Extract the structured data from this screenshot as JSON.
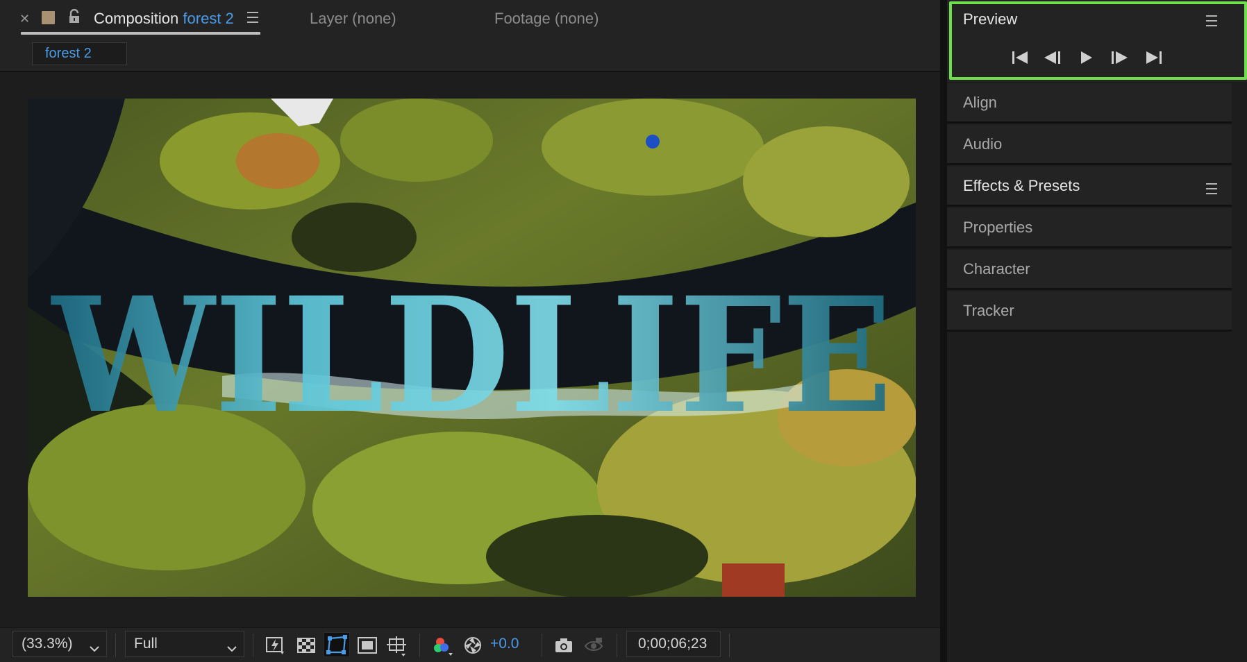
{
  "composition_tab": {
    "prefix": "Composition",
    "name": "forest 2",
    "layer_tab": "Layer (none)",
    "footage_tab": "Footage (none)",
    "breadcrumb": "forest 2"
  },
  "viewer": {
    "overlay_text": "WILDLIFE"
  },
  "toolbar": {
    "zoom": "(33.3%)",
    "resolution": "Full",
    "exposure": "+0.0",
    "timecode": "0;00;06;23"
  },
  "panels": {
    "preview": "Preview",
    "align": "Align",
    "audio": "Audio",
    "effects": "Effects & Presets",
    "properties": "Properties",
    "character": "Character",
    "tracker": "Tracker"
  },
  "colors": {
    "accent_blue": "#4a9be8",
    "highlight_green": "#6fe04b",
    "label_swatch": "#a89273"
  },
  "icons": [
    "close-icon",
    "lock-icon",
    "panel-menu-icon",
    "chevron-down-icon",
    "fast-preview-icon",
    "transparency-grid-icon",
    "mask-path-icon",
    "region-of-interest-icon",
    "guides-icon",
    "color-channels-icon",
    "exposure-reset-icon",
    "snapshot-icon",
    "show-snapshot-icon",
    "first-frame-icon",
    "previous-frame-icon",
    "play-icon",
    "next-frame-icon",
    "last-frame-icon"
  ]
}
